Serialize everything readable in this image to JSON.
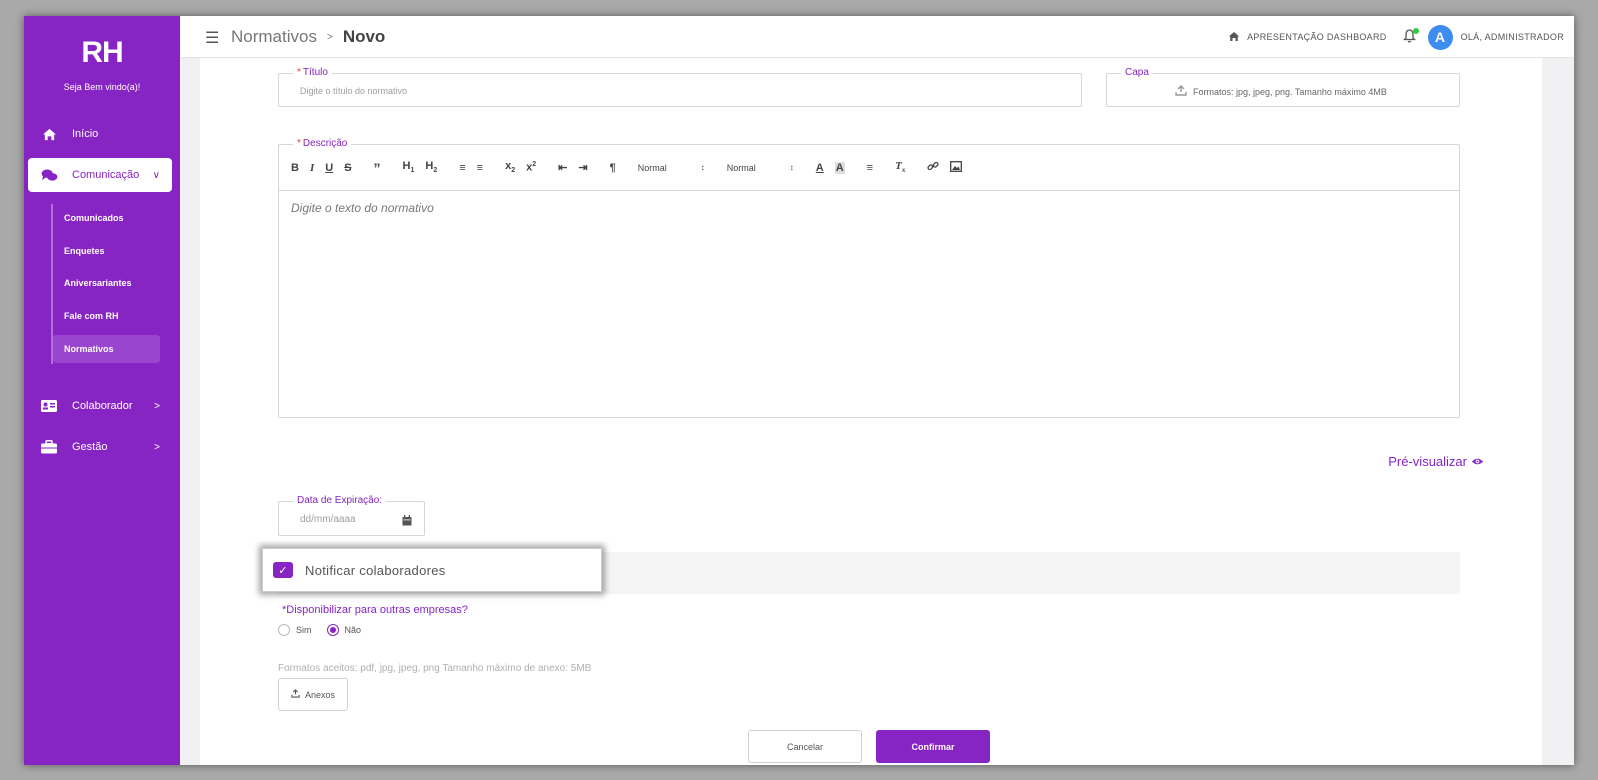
{
  "colors": {
    "brand": "#8624c4",
    "avatar": "#3d8cf0",
    "online": "#2ecc40",
    "required": "#e53935"
  },
  "sidebar": {
    "logo": "RH",
    "welcome": "Seja Bem vindo(a)!",
    "items": [
      {
        "label": "Início",
        "icon": "home-icon"
      },
      {
        "label": "Comunicação",
        "icon": "chat-icon",
        "expanded": true
      },
      {
        "label": "Colaborador",
        "icon": "id-card-icon"
      },
      {
        "label": "Gestão",
        "icon": "briefcase-icon"
      }
    ],
    "submenu": [
      "Comunicados",
      "Enquetes",
      "Aniversariantes",
      "Fale com RH",
      "Normativos"
    ],
    "active_submenu": "Normativos"
  },
  "header": {
    "breadcrumb_root": "Normativos",
    "breadcrumb_sep": ">",
    "breadcrumb_current": "Novo",
    "dashboard_link": "APRESENTAÇÃO DASHBOARD",
    "avatar_initial": "A",
    "greeting": "OLÁ, ADMINISTRADOR"
  },
  "form": {
    "title_label": "Título",
    "title_placeholder": "Digite o título do normativo",
    "cover_label": "Capa",
    "cover_hint": "Formatos: jpg, jpeg, png. Tamanho máximo 4MB",
    "description_label": "Descrição",
    "editor_placeholder": "Digite o texto do normativo",
    "font_select": "Normal",
    "size_select": "Normal",
    "preview_link": "Pré-visualizar",
    "expiration_label": "Data de Expiração:",
    "expiration_placeholder": "dd/mm/aaaa",
    "notify_label": "Notificar colaboradores",
    "notify_checked": true,
    "share_question": "*Disponibilizar para outras empresas?",
    "option_yes": "Sim",
    "option_no": "Não",
    "selected_option": "Não",
    "attach_formats": "Formatos aceitos: pdf, jpg, jpeg, png Tamanho máximo de anexo: 5MB",
    "attach_button": "Anexos",
    "cancel_button": "Cancelar",
    "confirm_button": "Confirmar"
  }
}
